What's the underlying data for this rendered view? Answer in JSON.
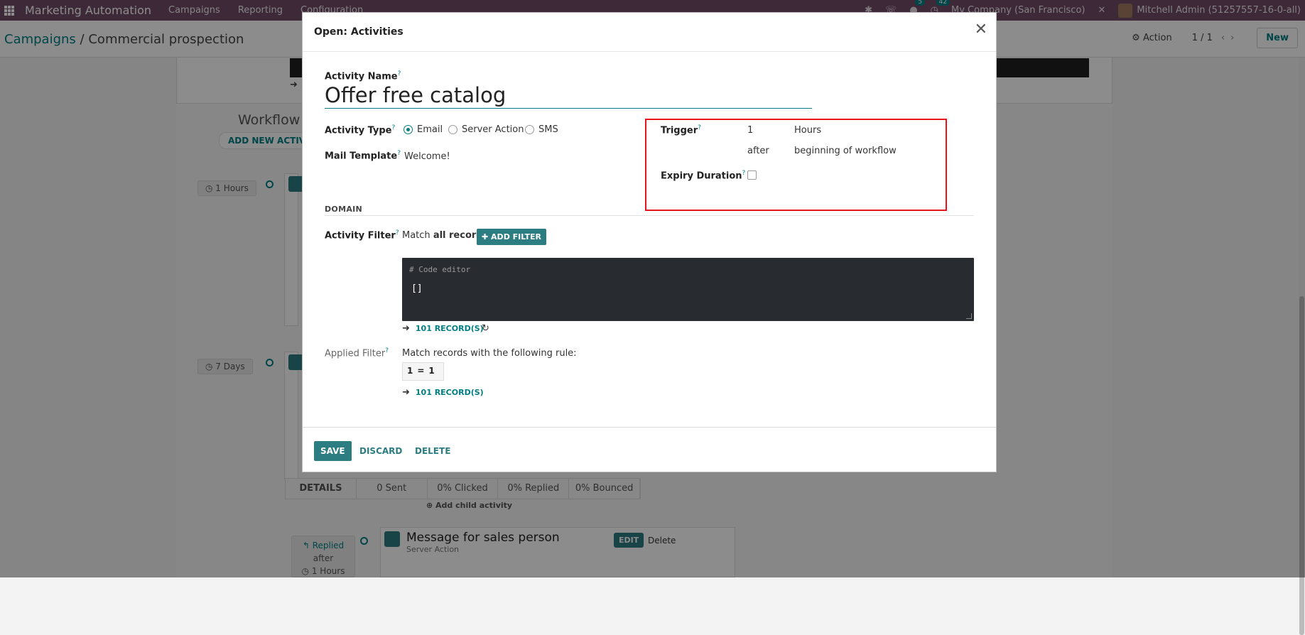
{
  "navbar": {
    "brand": "Marketing Automation",
    "menu": [
      "Campaigns",
      "Reporting",
      "Configuration"
    ],
    "chat_count": "5",
    "activity_count": "42",
    "company": "My Company (San Francisco)",
    "user": "Mitchell Admin (51257557-16-0-all)"
  },
  "control": {
    "breadcrumb_parent": "Campaigns",
    "breadcrumb_sep": "/",
    "breadcrumb_current": "Commercial prospection",
    "action_label": "Action",
    "pager": "1 / 1",
    "new_label": "New"
  },
  "background": {
    "workflow_title": "Workflow",
    "add_new_activity": "ADD NEW ACTIVI",
    "pill1": "1 Hours",
    "pill2": "7 Days",
    "stats": [
      "DETAILS",
      "0 Sent",
      "0% Clicked",
      "0% Replied",
      "0% Bounced"
    ],
    "add_child": "Add child activity",
    "replied": "Replied",
    "after": "after",
    "hours": "1 Hours",
    "msg_title": "Message for sales person",
    "msg_sub": "Server Action",
    "edit": "EDIT",
    "delete": "Delete"
  },
  "modal": {
    "title": "Open: Activities",
    "activity_name_label": "Activity Name",
    "activity_name_value": "Offer free catalog",
    "activity_type_label": "Activity Type",
    "activity_type_options": [
      "Email",
      "Server Action",
      "SMS"
    ],
    "activity_type_selected": "Email",
    "mail_template_label": "Mail Template",
    "mail_template_value": "Welcome!",
    "trigger_label": "Trigger",
    "trigger_interval": "1",
    "trigger_unit": "Hours",
    "trigger_when": "after",
    "trigger_event": "beginning of workflow",
    "expiry_label": "Expiry Duration",
    "expiry_checked": false,
    "domain_title": "DOMAIN",
    "activity_filter_label": "Activity Filter",
    "match_prefix": "Match",
    "match_all": "all records",
    "add_filter": "ADD FILTER",
    "code_comment": "# Code editor",
    "code_value": "[]",
    "records_link": "101 RECORD(S)",
    "applied_filter_label": "Applied Filter",
    "applied_filter_text": "Match records with the following rule:",
    "rule_left": "1",
    "rule_op": "=",
    "rule_right": "1",
    "records_link2": "101 RECORD(S)",
    "save": "SAVE",
    "discard": "DISCARD",
    "delete": "DELETE"
  },
  "colors": {
    "navbar": "#714b67",
    "accent": "#017e84",
    "button": "#2c7d82",
    "highlight": "#e8161c"
  }
}
